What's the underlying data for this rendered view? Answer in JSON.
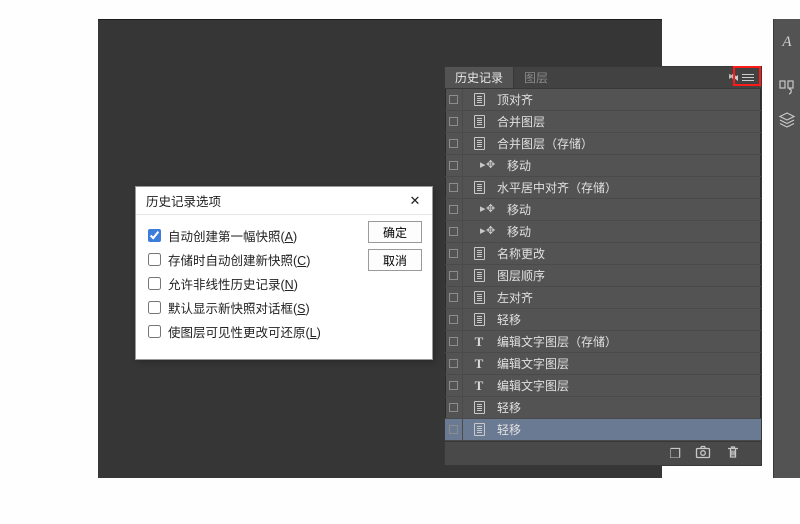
{
  "panel": {
    "tabs": {
      "history": "历史记录",
      "layers": "图层"
    },
    "rows": [
      {
        "icon": "page",
        "label": "顶对齐",
        "indent": false
      },
      {
        "icon": "page",
        "label": "合并图层",
        "indent": false
      },
      {
        "icon": "page",
        "label": "合并图层（存储）",
        "indent": false
      },
      {
        "icon": "move",
        "label": "移动",
        "indent": true
      },
      {
        "icon": "page",
        "label": "水平居中对齐（存储）",
        "indent": false
      },
      {
        "icon": "move",
        "label": "移动",
        "indent": true
      },
      {
        "icon": "move",
        "label": "移动",
        "indent": true
      },
      {
        "icon": "page",
        "label": "名称更改",
        "indent": false
      },
      {
        "icon": "page",
        "label": "图层顺序",
        "indent": false
      },
      {
        "icon": "page",
        "label": "左对齐",
        "indent": false
      },
      {
        "icon": "page",
        "label": "轻移",
        "indent": false
      },
      {
        "icon": "text",
        "label": "编辑文字图层（存储）",
        "indent": false
      },
      {
        "icon": "text",
        "label": "编辑文字图层",
        "indent": false
      },
      {
        "icon": "text",
        "label": "编辑文字图层",
        "indent": false
      },
      {
        "icon": "page",
        "label": "轻移",
        "indent": false
      },
      {
        "icon": "page",
        "label": "轻移",
        "indent": false,
        "selected": true
      }
    ],
    "text_glyph": "T",
    "footer": {
      "new_doc": "❐",
      "snapshot": "📷",
      "trash": "🗑"
    }
  },
  "right_bar": {
    "a_glyph": "A"
  },
  "dialog": {
    "title": "历史记录选项",
    "options": [
      {
        "label_pre": "自动创建第一幅快照(",
        "mn": "A",
        "label_post": ")",
        "checked": true
      },
      {
        "label_pre": "存储时自动创建新快照(",
        "mn": "C",
        "label_post": ")",
        "checked": false
      },
      {
        "label_pre": "允许非线性历史记录(",
        "mn": "N",
        "label_post": ")",
        "checked": false
      },
      {
        "label_pre": "默认显示新快照对话框(",
        "mn": "S",
        "label_post": ")",
        "checked": false
      },
      {
        "label_pre": "使图层可见性更改可还原(",
        "mn": "L",
        "label_post": ")",
        "checked": false
      }
    ],
    "ok": "确定",
    "cancel": "取消",
    "close_glyph": "✕"
  }
}
